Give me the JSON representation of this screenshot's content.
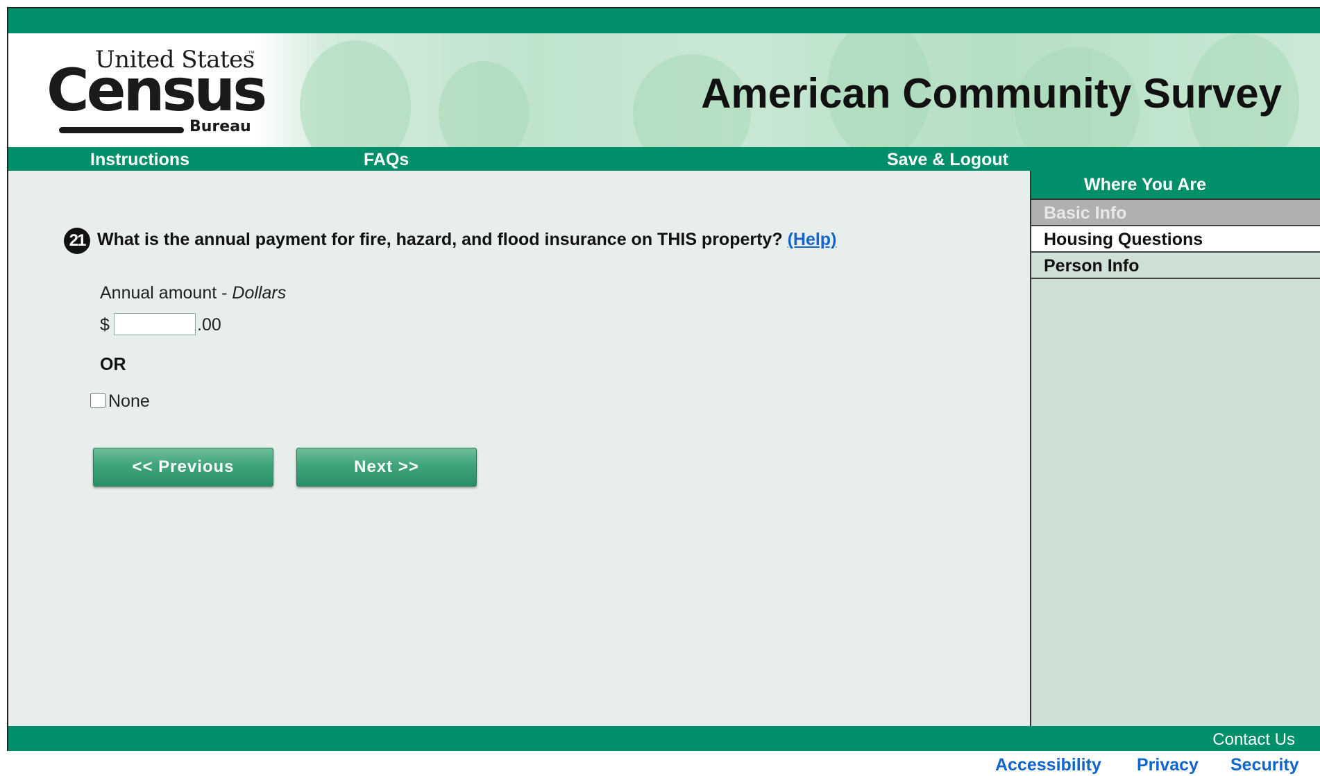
{
  "header": {
    "logo_line1": "United States",
    "logo_tm": "™",
    "logo_census": "Census",
    "logo_bureau": "Bureau",
    "title": "American Community Survey"
  },
  "nav": {
    "instructions": "Instructions",
    "faqs": "FAQs",
    "save_logout": "Save & Logout"
  },
  "question": {
    "number": "21",
    "text": "What is the annual payment for fire, hazard, and flood insurance on THIS property?",
    "help_label": "(Help)",
    "amount_label": "Annual amount - ",
    "amount_unit": "Dollars",
    "currency_symbol": "$",
    "amount_value": "",
    "cents_suffix": ".00",
    "or_label": "OR",
    "none_label": "None"
  },
  "buttons": {
    "previous": "<<   Previous",
    "next": "Next   >>"
  },
  "sidebar": {
    "title": "Where You Are",
    "items": [
      {
        "label": "Basic Info",
        "state": "disabled"
      },
      {
        "label": "Housing Questions",
        "state": "current"
      },
      {
        "label": "Person Info",
        "state": "normal"
      }
    ]
  },
  "footer": {
    "contact_us": "Contact Us",
    "links": [
      "Accessibility",
      "Privacy",
      "Security"
    ]
  },
  "colors": {
    "accent_green": "#008f6b",
    "link_blue": "#1166cc",
    "content_background": "#e8eeeb",
    "sidebar_background": "#cfe0d7"
  }
}
